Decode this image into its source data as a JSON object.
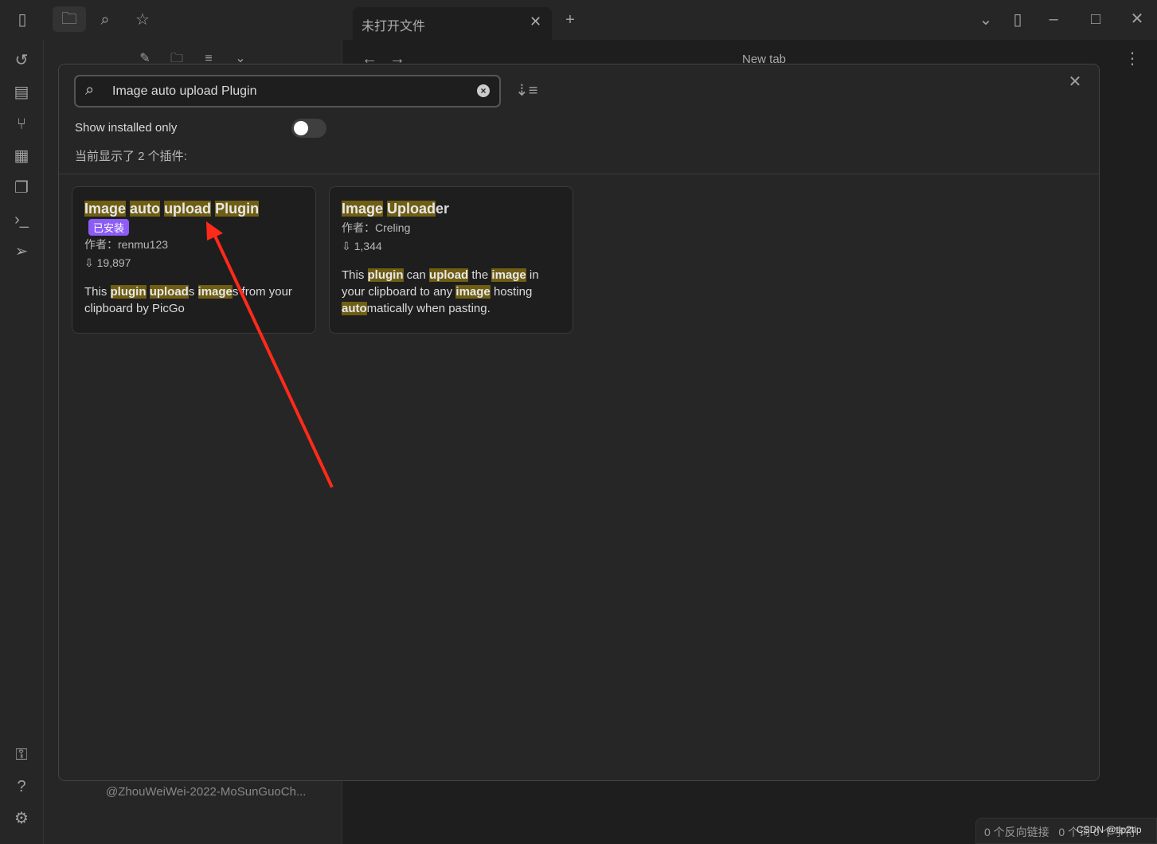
{
  "titlebar": {
    "tab_title": "未打开文件",
    "new_tab_heading": "New tab"
  },
  "modal": {
    "search_value": "Image auto upload Plugin",
    "show_installed_label": "Show installed only",
    "show_installed_on": false,
    "count_text": "当前显示了 2 个插件:",
    "plugins": [
      {
        "name": "Image auto upload Plugin",
        "badge": "已安装",
        "author": "作者：renmu123",
        "downloads": "19,897",
        "desc": "This plugin uploads images from your clipboard by PicGo"
      },
      {
        "name": "Image Uploader",
        "author": "作者：Creling",
        "downloads": "1,344",
        "desc": "This plugin can upload the image in your clipboard to any image hosting automatically when pasting."
      }
    ]
  },
  "sidebar": {
    "file_item": "@ZhouWeiWei-2022-MoSunGuoCh..."
  },
  "status": {
    "backlinks": "0 个反向链接",
    "words": "0 个词 0 个字符"
  },
  "watermark": "CSDN @tip2tip",
  "colors": {
    "highlight": "#6f5e14",
    "badge": "#8b5cf6",
    "annotation_arrow": "#ff2a1a"
  }
}
